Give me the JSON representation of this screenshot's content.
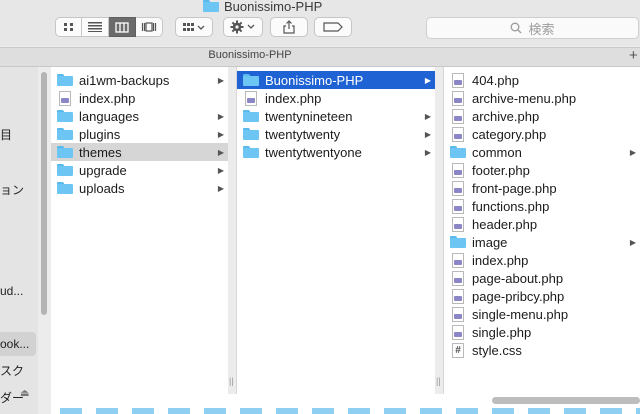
{
  "window": {
    "title": "Buonissimo-PHP",
    "path_label": "Buonissimo-PHP"
  },
  "toolbar": {
    "view_icons": [
      "icon-view-icon",
      "list-view-icon",
      "column-view-icon",
      "gallery-view-icon"
    ],
    "active_view": "column-view-icon",
    "search_placeholder": "検索"
  },
  "sidebar": {
    "items": [
      {
        "label": "目"
      },
      {
        "label": "ョン"
      },
      {
        "label": "ud..."
      },
      {
        "label": "ook..."
      },
      {
        "label": "スク"
      },
      {
        "label": "ダー"
      }
    ]
  },
  "columns": [
    {
      "items": [
        {
          "name": "ai1wm-backups",
          "type": "folder",
          "has_children": true
        },
        {
          "name": "index.php",
          "type": "php",
          "has_children": false
        },
        {
          "name": "languages",
          "type": "folder",
          "has_children": true
        },
        {
          "name": "plugins",
          "type": "folder",
          "has_children": true
        },
        {
          "name": "themes",
          "type": "folder",
          "has_children": true,
          "state": "highlighted"
        },
        {
          "name": "upgrade",
          "type": "folder",
          "has_children": true
        },
        {
          "name": "uploads",
          "type": "folder",
          "has_children": true
        }
      ]
    },
    {
      "items": [
        {
          "name": "Buonissimo-PHP",
          "type": "folder",
          "has_children": true,
          "state": "selected"
        },
        {
          "name": "index.php",
          "type": "php",
          "has_children": false
        },
        {
          "name": "twentynineteen",
          "type": "folder",
          "has_children": true
        },
        {
          "name": "twentytwenty",
          "type": "folder",
          "has_children": true
        },
        {
          "name": "twentytwentyone",
          "type": "folder",
          "has_children": true
        }
      ]
    },
    {
      "items": [
        {
          "name": "404.php",
          "type": "php",
          "has_children": false
        },
        {
          "name": "archive-menu.php",
          "type": "php",
          "has_children": false
        },
        {
          "name": "archive.php",
          "type": "php",
          "has_children": false
        },
        {
          "name": "category.php",
          "type": "php",
          "has_children": false
        },
        {
          "name": "common",
          "type": "folder",
          "has_children": true
        },
        {
          "name": "footer.php",
          "type": "php",
          "has_children": false
        },
        {
          "name": "front-page.php",
          "type": "php",
          "has_children": false
        },
        {
          "name": "functions.php",
          "type": "php",
          "has_children": false
        },
        {
          "name": "header.php",
          "type": "php",
          "has_children": false
        },
        {
          "name": "image",
          "type": "folder",
          "has_children": true
        },
        {
          "name": "index.php",
          "type": "php",
          "has_children": false
        },
        {
          "name": "page-about.php",
          "type": "php",
          "has_children": false
        },
        {
          "name": "page-pribcy.php",
          "type": "php",
          "has_children": false
        },
        {
          "name": "single-menu.php",
          "type": "php",
          "has_children": false
        },
        {
          "name": "single.php",
          "type": "php",
          "has_children": false
        },
        {
          "name": "style.css",
          "type": "css",
          "has_children": false
        }
      ]
    }
  ],
  "colors": {
    "selection": "#1f62d3",
    "highlight": "#d6d6d6",
    "folder": "#6cc5f3"
  }
}
